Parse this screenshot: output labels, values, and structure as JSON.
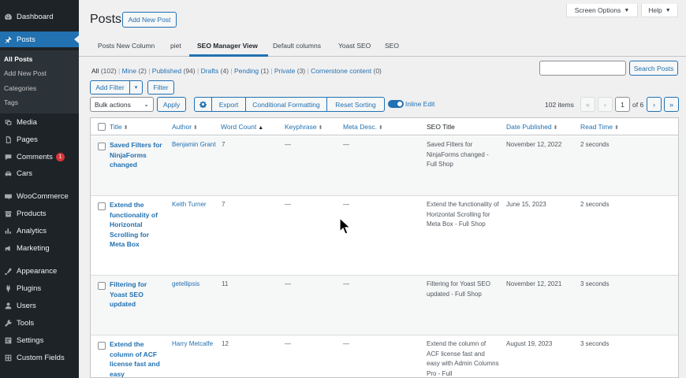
{
  "sidebar": {
    "items": [
      {
        "label": "Dashboard",
        "icon": "dashboard-icon"
      },
      {
        "label": "Posts",
        "icon": "pin-icon",
        "active": true
      },
      {
        "label": "Media",
        "icon": "media-icon"
      },
      {
        "label": "Pages",
        "icon": "pages-icon"
      },
      {
        "label": "Comments",
        "icon": "comments-icon",
        "badge": "1"
      },
      {
        "label": "Cars",
        "icon": "cars-icon"
      },
      {
        "label": "WooCommerce",
        "icon": "woocommerce-icon"
      },
      {
        "label": "Products",
        "icon": "products-icon"
      },
      {
        "label": "Analytics",
        "icon": "analytics-icon"
      },
      {
        "label": "Marketing",
        "icon": "marketing-icon"
      },
      {
        "label": "Appearance",
        "icon": "appearance-icon"
      },
      {
        "label": "Plugins",
        "icon": "plugins-icon"
      },
      {
        "label": "Users",
        "icon": "users-icon"
      },
      {
        "label": "Tools",
        "icon": "tools-icon"
      },
      {
        "label": "Settings",
        "icon": "settings-icon"
      },
      {
        "label": "Custom Fields",
        "icon": "custom-fields-icon"
      }
    ],
    "submenu": [
      "All Posts",
      "Add New Post",
      "Categories",
      "Tags"
    ]
  },
  "header": {
    "screen_options": "Screen Options",
    "help": "Help",
    "title": "Posts",
    "add_new": "Add New Post"
  },
  "tabs": [
    "Posts New Column",
    "piet",
    "SEO Manager View",
    "Default columns",
    "Yoast SEO",
    "SEO"
  ],
  "filters": {
    "all": "All",
    "all_count": "(102)",
    "mine": "Mine",
    "mine_count": "(2)",
    "published": "Published",
    "published_count": "(94)",
    "drafts": "Drafts",
    "drafts_count": "(4)",
    "pending": "Pending",
    "pending_count": "(1)",
    "private": "Private",
    "private_count": "(3)",
    "cornerstone": "Cornerstone content",
    "cornerstone_count": "(0)"
  },
  "search": {
    "button": "Search Posts"
  },
  "toolbar": {
    "add_filter": "Add Filter",
    "filter": "Filter",
    "bulk_actions": "Bulk actions",
    "apply": "Apply",
    "export": "Export",
    "conditional_formatting": "Conditional Formatting",
    "reset_sorting": "Reset Sorting",
    "inline_edit": "Inline Edit"
  },
  "pagination": {
    "items": "102 items",
    "first": "«",
    "prev": "‹",
    "current": "1",
    "of": "of 6",
    "next": "›",
    "last": "»"
  },
  "table": {
    "columns": [
      "Title",
      "Author",
      "Word Count",
      "Keyphrase",
      "Meta Desc.",
      "SEO Title",
      "Date Published",
      "Read Time"
    ],
    "rows": [
      {
        "title": "Saved Filters for NinjaForms changed",
        "author": "Benjamin Grant",
        "words": "7",
        "keyphrase": "—",
        "meta": "—",
        "seo_title": "Saved Filters for NinjaForms changed - Full Shop",
        "date": "November 12, 2022",
        "read": "2 seconds"
      },
      {
        "title": "Extend the functionality of Horizontal Scrolling for Meta Box",
        "author": "Keith Turner",
        "words": "7",
        "keyphrase": "—",
        "meta": "—",
        "seo_title": "Extend the functionality of Horizontal Scrolling for Meta Box - Full Shop",
        "date": "June 15, 2023",
        "read": "2 seconds"
      },
      {
        "title": "Filtering for Yoast SEO updated",
        "author": "getellipsis",
        "words": "11",
        "keyphrase": "—",
        "meta": "—",
        "seo_title": "Filtering for Yoast SEO updated - Full Shop",
        "date": "November 12, 2021",
        "read": "3 seconds"
      },
      {
        "title": "Extend the column of ACF license fast and easy",
        "author": "Harry Metcalfe",
        "words": "12",
        "keyphrase": "—",
        "meta": "—",
        "seo_title": "Extend the column of ACF license fast and easy with Admin Columns Pro - Full",
        "date": "August 19, 2023",
        "read": "3 seconds"
      }
    ]
  }
}
